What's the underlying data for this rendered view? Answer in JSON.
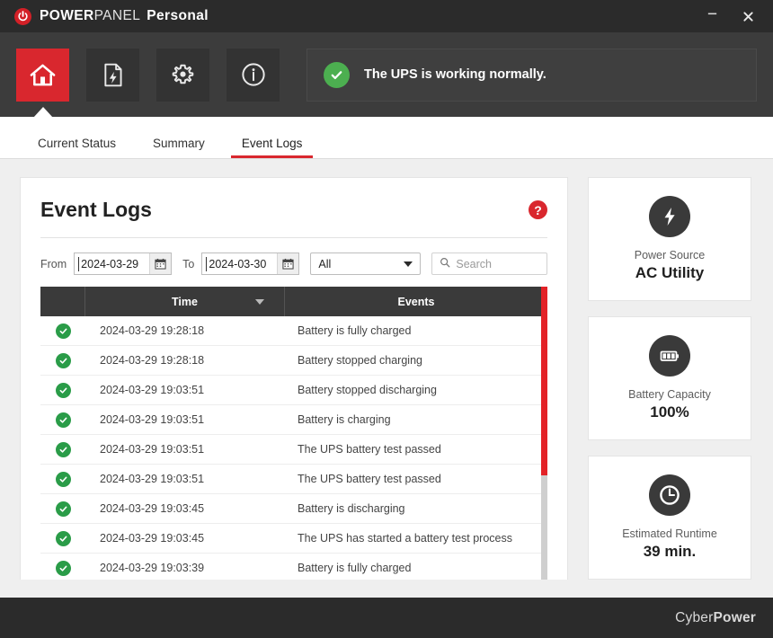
{
  "window": {
    "app_name_bold": "POWER",
    "app_name_light": "PANEL",
    "app_edition": "Personal",
    "minimize_label": "—",
    "close_label": "✕",
    "logo_icon": "power-button-icon"
  },
  "toolbar": {
    "items": [
      {
        "name": "home",
        "icon": "home-icon",
        "active": true
      },
      {
        "name": "report",
        "icon": "document-lightning-icon",
        "active": false
      },
      {
        "name": "settings",
        "icon": "gear-icon",
        "active": false
      },
      {
        "name": "information",
        "icon": "info-circle-icon",
        "active": false
      }
    ],
    "status": {
      "icon": "check-circle-icon",
      "text": "The UPS is working normally.",
      "color": "#4caf50"
    }
  },
  "tabs": [
    {
      "label": "Current Status",
      "active": false
    },
    {
      "label": "Summary",
      "active": false
    },
    {
      "label": "Event Logs",
      "active": true
    }
  ],
  "logs": {
    "title": "Event Logs",
    "help_label": "?",
    "filters": {
      "from_label": "From",
      "from_value": "2024-03-29",
      "to_label": "To",
      "to_value": "2024-03-30",
      "calendar_icon": "calendar-icon",
      "type_selected": "All",
      "type_options": [
        "All"
      ],
      "search_placeholder": "Search",
      "search_value": "",
      "search_icon": "search-icon"
    },
    "columns": {
      "status": "",
      "time": "Time",
      "events": "Events"
    },
    "sort": {
      "column": "Time",
      "direction": "desc"
    },
    "rows": [
      {
        "status": "ok",
        "time": "2024-03-29 19:28:18",
        "event": "Battery is fully charged"
      },
      {
        "status": "ok",
        "time": "2024-03-29 19:28:18",
        "event": "Battery stopped charging"
      },
      {
        "status": "ok",
        "time": "2024-03-29 19:03:51",
        "event": "Battery stopped discharging"
      },
      {
        "status": "ok",
        "time": "2024-03-29 19:03:51",
        "event": "Battery is charging"
      },
      {
        "status": "ok",
        "time": "2024-03-29 19:03:51",
        "event": "The UPS battery test passed"
      },
      {
        "status": "ok",
        "time": "2024-03-29 19:03:51",
        "event": "The UPS battery test passed"
      },
      {
        "status": "ok",
        "time": "2024-03-29 19:03:45",
        "event": "Battery is discharging"
      },
      {
        "status": "ok",
        "time": "2024-03-29 19:03:45",
        "event": "The UPS has started a battery test process"
      },
      {
        "status": "ok",
        "time": "2024-03-29 19:03:39",
        "event": "Battery is fully charged"
      }
    ],
    "scrollbar_color": "#e32227"
  },
  "side_cards": [
    {
      "icon": "lightning-bolt-icon",
      "label": "Power Source",
      "value": "AC Utility"
    },
    {
      "icon": "battery-full-icon",
      "label": "Battery Capacity",
      "value": "100%"
    },
    {
      "icon": "clock-icon",
      "label": "Estimated Runtime",
      "value": "39 min."
    }
  ],
  "footer": {
    "brand_first": "Cyber",
    "brand_second": "Power"
  },
  "colors": {
    "accent_red": "#d9272e",
    "toolbar_dark": "#3c3c3c",
    "title_dark": "#2b2b2b",
    "status_green": "#4caf50",
    "page_bg": "#efefef"
  }
}
